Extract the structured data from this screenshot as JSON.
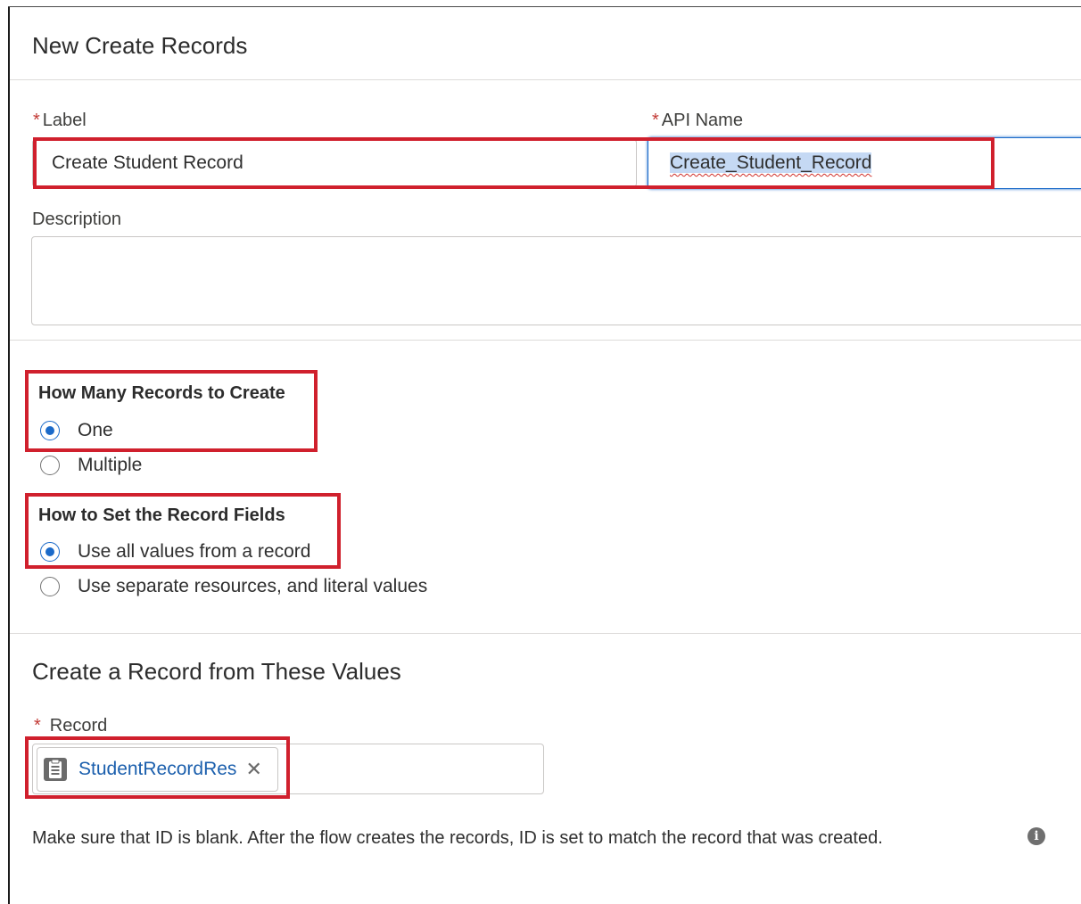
{
  "modal": {
    "title": "New Create Records"
  },
  "fields": {
    "label": {
      "required_marker": "*",
      "label": "Label",
      "value": "Create Student Record"
    },
    "api_name": {
      "required_marker": "*",
      "label": "API Name",
      "value": "Create_Student_Record"
    },
    "description": {
      "label": "Description",
      "value": ""
    }
  },
  "how_many": {
    "title": "How Many Records to Create",
    "options": [
      {
        "label": "One",
        "checked": true
      },
      {
        "label": "Multiple",
        "checked": false
      }
    ]
  },
  "how_to_set": {
    "title": "How to Set the Record Fields",
    "options": [
      {
        "label": "Use all values from a record",
        "checked": true
      },
      {
        "label": "Use separate resources, and literal values",
        "checked": false
      }
    ]
  },
  "record_section": {
    "title": "Create a Record from These Values",
    "record_field": {
      "required_marker": "*",
      "label": "Record",
      "pill": {
        "label": "StudentRecordRes",
        "icon": "record-resource-icon",
        "remove_icon": "close-icon"
      }
    },
    "help_text": "Make sure that ID is blank. After the flow creates the records, ID is set to match the record that was created.",
    "help_icon": "info-icon"
  },
  "colors": {
    "annotation_red": "#d0202d",
    "radio_blue": "#1b6ac9",
    "link_blue": "#1b5fad",
    "required_red": "#c23934"
  }
}
